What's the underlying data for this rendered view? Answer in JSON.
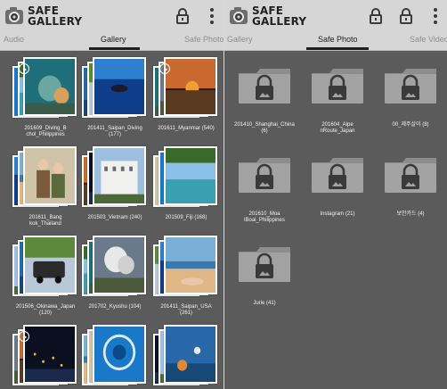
{
  "brand": {
    "line1": "SAFE",
    "line2": "GALLERY"
  },
  "icons": {
    "logo": "camera-logo-icon",
    "lock": "lock-icon",
    "menu": "more-vert-icon",
    "folder": "locked-folder-icon",
    "video": "play-icon"
  },
  "left_screen": {
    "tabs": {
      "left": "Audio",
      "center": "Gallery",
      "right": "Safe Photo"
    },
    "albums": [
      {
        "caption": "201609_Diving_B\nchol_Philippines",
        "video": true
      },
      {
        "caption": "201411_Saipan_Diving\n(177)",
        "video": false
      },
      {
        "caption": "201611_Myanmar (540)",
        "video": true
      },
      {
        "caption": "201611_Bang\nkok_Thailand",
        "video": false
      },
      {
        "caption": "201503_Vietnam (240)",
        "video": false
      },
      {
        "caption": "201509_Fiji (168)",
        "video": false
      },
      {
        "caption": "201506_Okinawa_Japan\n(120)",
        "video": false
      },
      {
        "caption": "201702_Kyushu (104)",
        "video": false
      },
      {
        "caption": "201411_Saipan_USA\n(261)",
        "video": false
      },
      {
        "caption": "",
        "video": true
      },
      {
        "caption": "",
        "video": false
      },
      {
        "caption": "",
        "video": false
      }
    ]
  },
  "right_screen": {
    "tabs": {
      "left": "Gallery",
      "center": "Safe Photo",
      "right": "Safe Video"
    },
    "folders": [
      {
        "caption": "201410_Shanghai_China\n(6)"
      },
      {
        "caption": "201604_Alpe\nnRoute_Japan"
      },
      {
        "caption": "00_제주살이 (8)"
      },
      {
        "caption": "201610_Moa\nlBoal_Philippines"
      },
      {
        "caption": "Instagram (21)"
      },
      {
        "caption": "보안카드 (4)"
      },
      {
        "caption": "Jurie (41)"
      }
    ]
  },
  "colors": {
    "background": "#5b5b5b",
    "appbar": "#d6d6d6",
    "indicator": "#1e1e1e",
    "folder": "#9a9a9a"
  }
}
